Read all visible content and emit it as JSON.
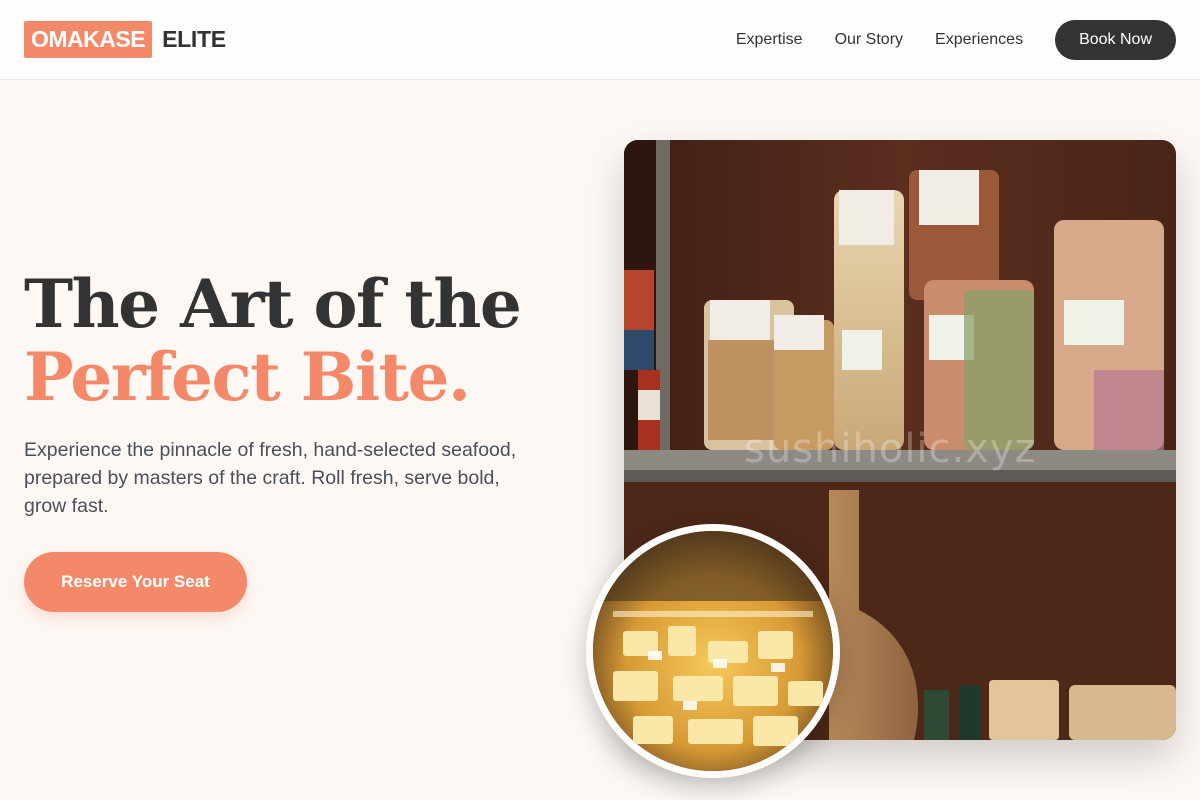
{
  "brand": {
    "badge": "OMAKASE",
    "name": "ELITE",
    "accent_color": "#f4896a"
  },
  "nav": {
    "links": [
      "Expertise",
      "Our Story",
      "Experiences"
    ],
    "cta": "Book Now"
  },
  "hero": {
    "title_line1": "The Art of the",
    "title_line2": "Perfect Bite.",
    "subtitle": "Experience the pinnacle of fresh, hand-selected seafood, prepared by masters of the craft. Roll fresh, serve bold, grow fast.",
    "cta": "Reserve Your Seat"
  },
  "media": {
    "main_image": "pasta-shelf-photo",
    "inset_image": "cheese-counter-photo",
    "watermark": "sushiholic.xyz"
  }
}
